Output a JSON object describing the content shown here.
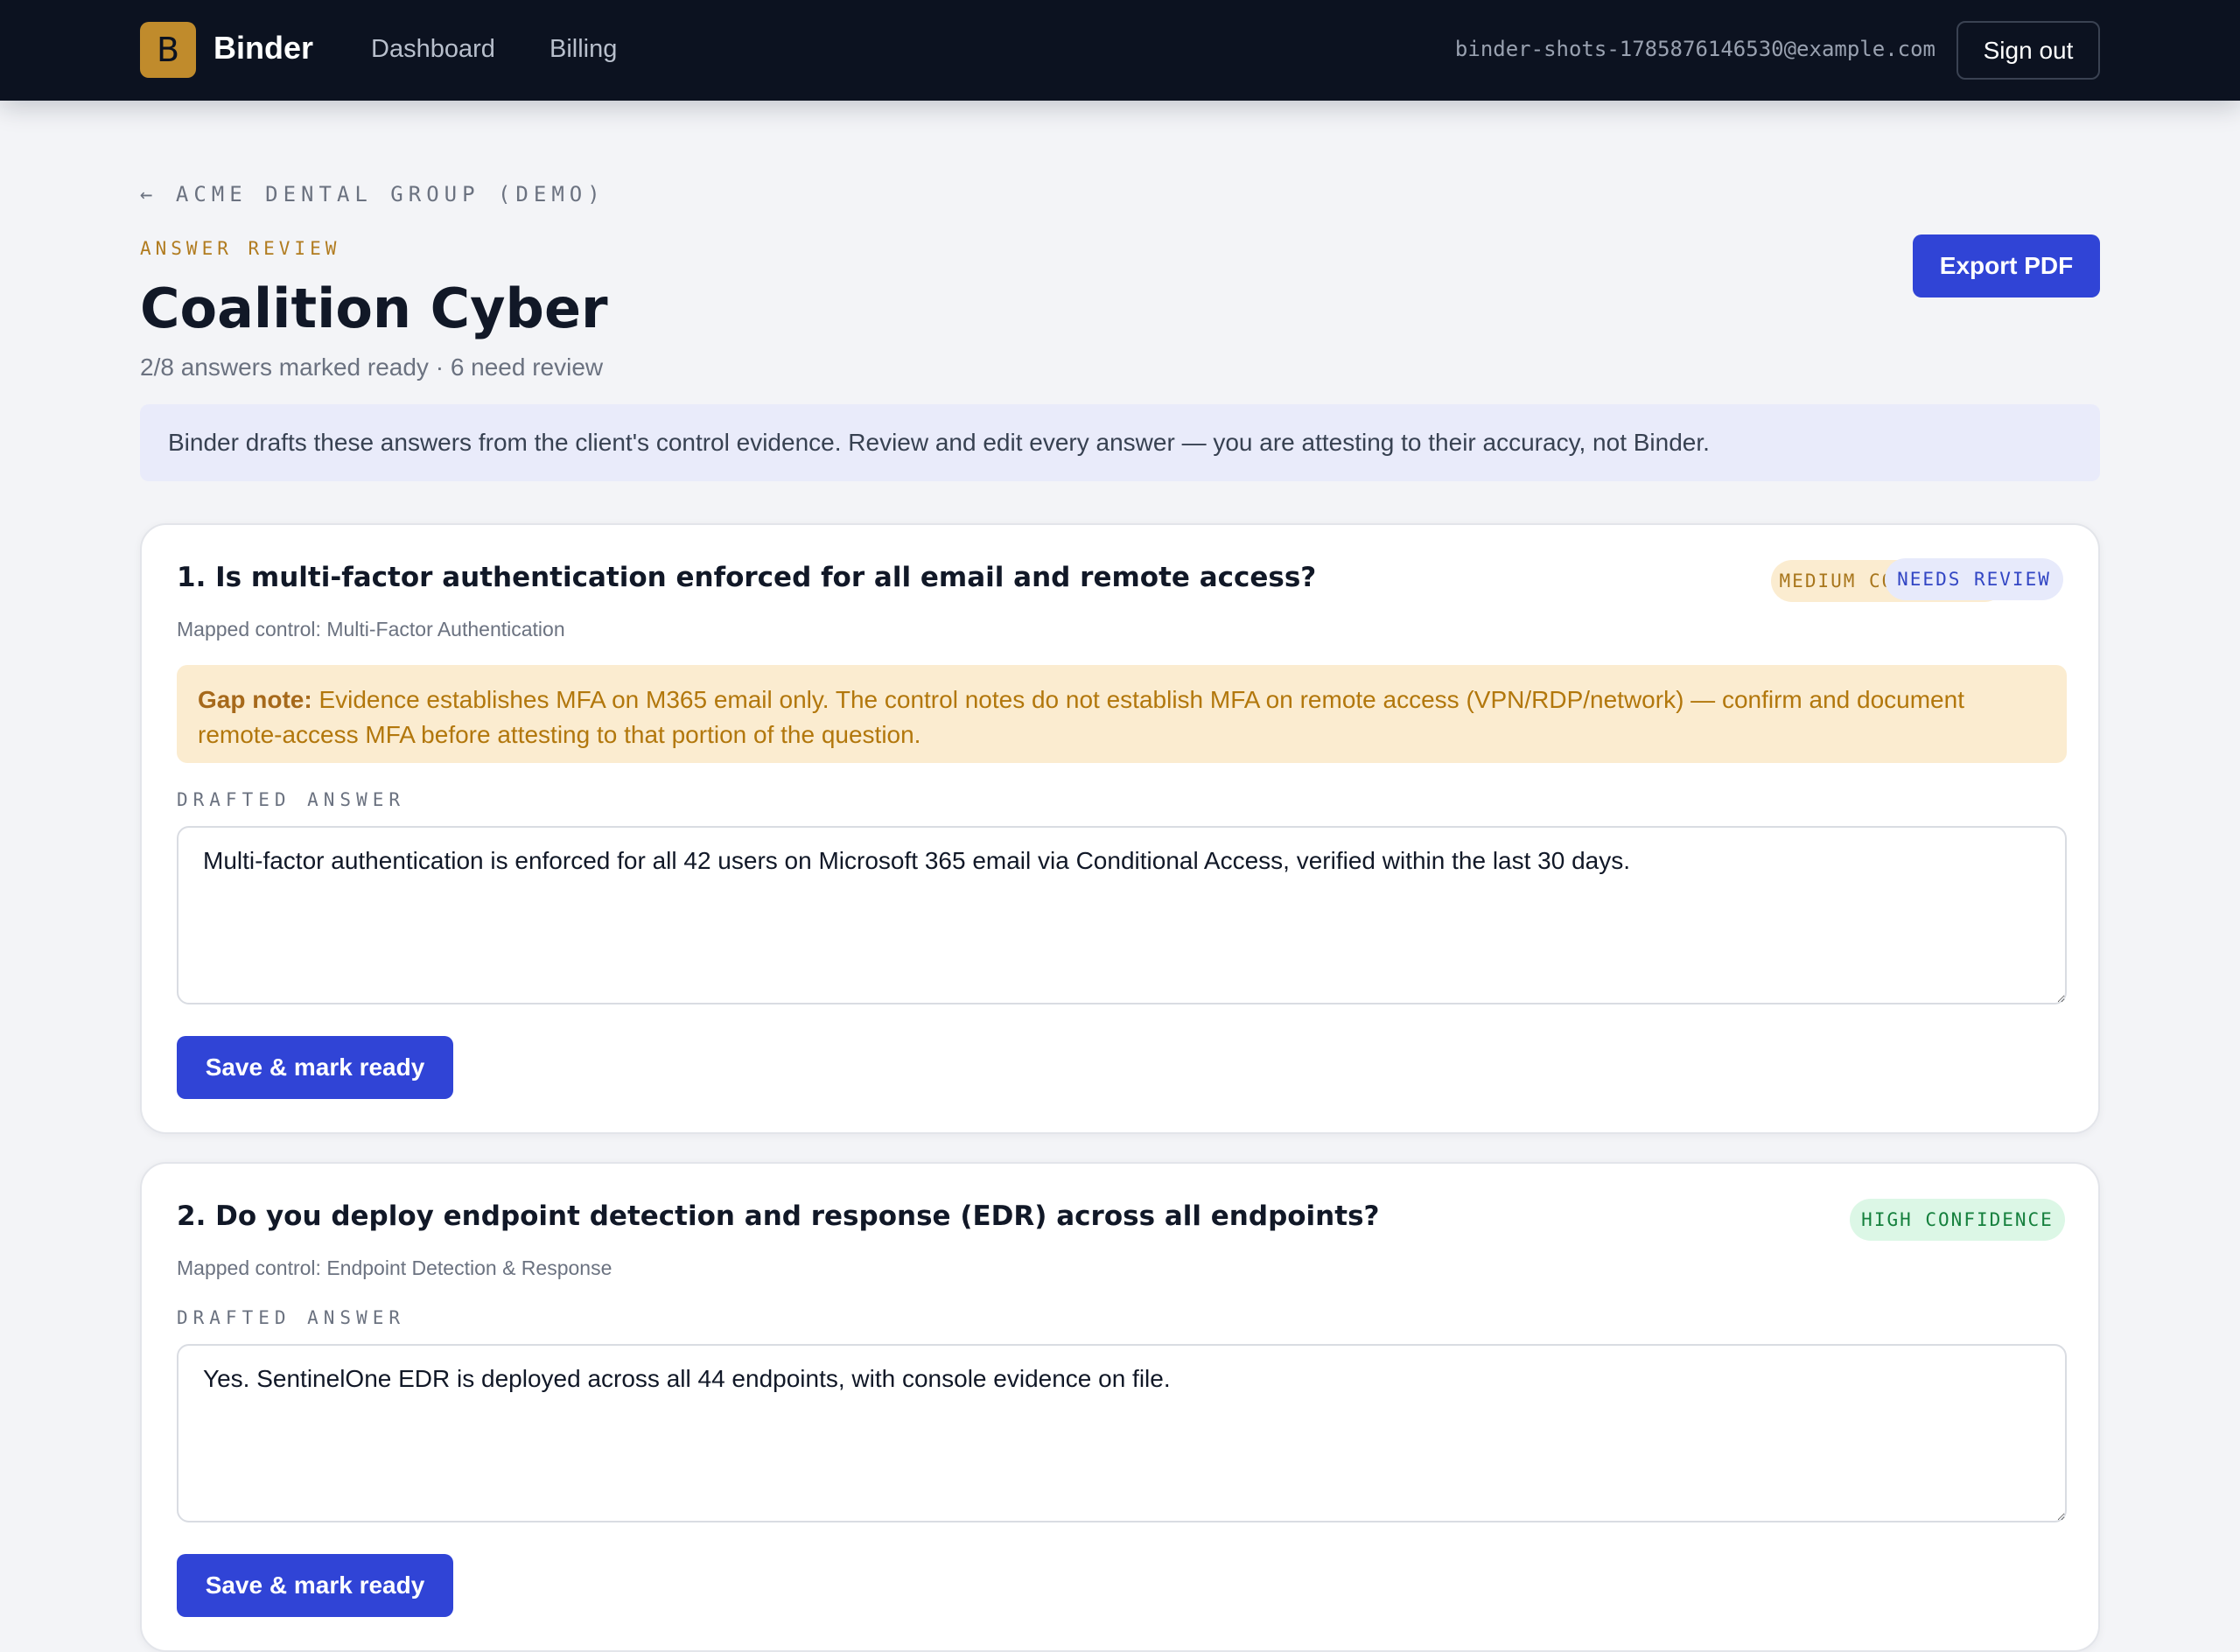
{
  "app": {
    "logo_letter": "B",
    "brand": "Binder",
    "nav": {
      "dashboard": "Dashboard",
      "billing": "Billing"
    },
    "user_email": "binder-shots-1785876146530@example.com",
    "sign_out": "Sign out"
  },
  "page": {
    "back_link": "← ACME DENTAL GROUP (DEMO)",
    "eyebrow": "ANSWER REVIEW",
    "title": "Coalition Cyber",
    "summary": "2/8 answers marked ready · 6 need review",
    "export_button": "Export PDF",
    "disclaimer": "Binder drafts these answers from the client's control evidence. Review and edit every answer — you are attesting to their accuracy, not Binder."
  },
  "questions": [
    {
      "title": "1. Is multi-factor authentication enforced for all email and remote access?",
      "mapped_control": "Mapped control: Multi-Factor Authentication",
      "badges": [
        "MEDIUM CONFIDENCE",
        "NEEDS REVIEW"
      ],
      "gap_note_label": "Gap note:",
      "gap_note": "Evidence establishes MFA on M365 email only. The control notes do not establish MFA on remote access (VPN/RDP/network) — confirm and document remote-access MFA before attesting to that portion of the question.",
      "answer_label": "DRAFTED ANSWER",
      "answer": "Multi-factor authentication is enforced for all 42 users on Microsoft 365 email via Conditional Access, verified within the last 30 days.",
      "save_button": "Save & mark ready"
    },
    {
      "title": "2. Do you deploy endpoint detection and response (EDR) across all endpoints?",
      "mapped_control": "Mapped control: Endpoint Detection & Response",
      "badges": [
        "HIGH CONFIDENCE"
      ],
      "answer_label": "DRAFTED ANSWER",
      "answer": "Yes. SentinelOne EDR is deployed across all 44 endpoints, with console evidence on file.",
      "save_button": "Save & mark ready"
    }
  ],
  "colors": {
    "topbar": "#0c1220",
    "accent": "#3044d6",
    "brand_gold": "#c08b2c",
    "warning_bg": "#fbecd0",
    "warning_text": "#b2770c",
    "success_bg": "#dcf7e6",
    "success_text": "#15803d"
  }
}
